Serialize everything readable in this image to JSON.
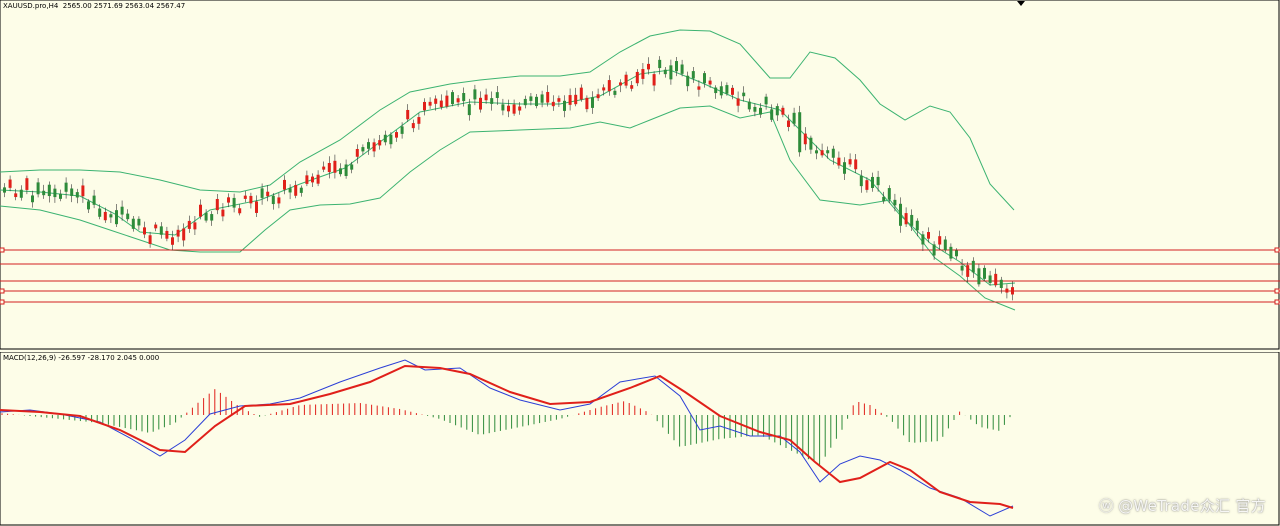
{
  "price_pane": {
    "title": "XAUUSD.pro,H4",
    "ohlc": "2565.00 2571.69 2563.04 2567.47"
  },
  "macd_pane": {
    "title": "MACD(12,26,9) -26.597 -28.170 2.045 0.000"
  },
  "watermark": {
    "text": "@WeTrade众汇 官方"
  },
  "colors": {
    "background": "#fdfde8",
    "bull_candle": "#e0201a",
    "bear_candle": "#2e8b3a",
    "bollinger": "#3cb371",
    "level_line": "#d42020",
    "macd_line": "#2c3fd6",
    "signal_line": "#e0201a",
    "hist_up": "#e0201a",
    "hist_down": "#2e8b3a"
  },
  "icons": {
    "shift_marker": "triangle-down-icon",
    "watermark_logo": "wetrade-logo-icon"
  }
}
